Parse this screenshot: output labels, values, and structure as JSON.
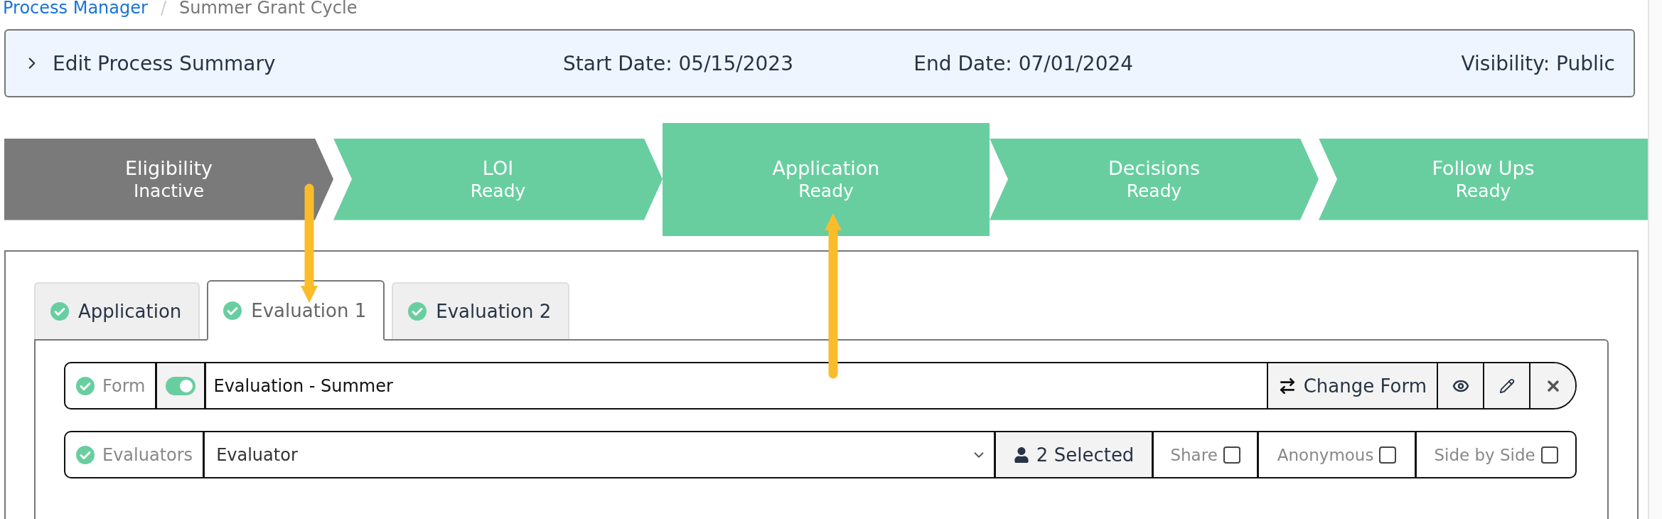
{
  "breadcrumb": {
    "items": [
      {
        "label": "Process Manager",
        "kind": "link"
      },
      {
        "label": "Summer Grant Cycle",
        "kind": "current"
      }
    ],
    "separator": "/"
  },
  "summary": {
    "title": "Edit Process Summary",
    "expanded": false,
    "fields": [
      "Start Date: 05/15/2023",
      "End Date: 07/01/2024",
      "Visibility: Public"
    ]
  },
  "stages": [
    {
      "name": "Eligibility",
      "status": "Inactive",
      "kind": "inactive",
      "selected": false
    },
    {
      "name": "LOI",
      "status": "Ready",
      "kind": "ready",
      "selected": false
    },
    {
      "name": "Application",
      "status": "Ready",
      "kind": "ready",
      "selected": true
    },
    {
      "name": "Decisions",
      "status": "Ready",
      "kind": "ready",
      "selected": false
    },
    {
      "name": "Follow Ups",
      "status": "Ready",
      "kind": "ready",
      "selected": false
    }
  ],
  "tabs": [
    {
      "label": "Application",
      "checked": true,
      "selected": false
    },
    {
      "label": "Evaluation 1",
      "checked": true,
      "selected": true
    },
    {
      "label": "Evaluation 2",
      "checked": true,
      "selected": false
    }
  ],
  "form_row": {
    "label": "Form",
    "checked": true,
    "on": true,
    "value": "Evaluation - Summer",
    "buttons": [
      {
        "kind": "change",
        "label": "Change Form"
      },
      {
        "kind": "view"
      },
      {
        "kind": "edit"
      },
      {
        "kind": "remove"
      }
    ]
  },
  "evaluators_row": {
    "label": "Evaluators",
    "checked": true,
    "value": "Evaluator",
    "selected_count": "2 Selected",
    "options": [
      {
        "label": "Share",
        "checked": false
      },
      {
        "label": "Anonymous",
        "checked": false
      },
      {
        "label": "Side by Side",
        "checked": false
      }
    ]
  },
  "annotations": [
    {
      "kind": "down_arrow"
    },
    {
      "kind": "up_arrow"
    }
  ]
}
